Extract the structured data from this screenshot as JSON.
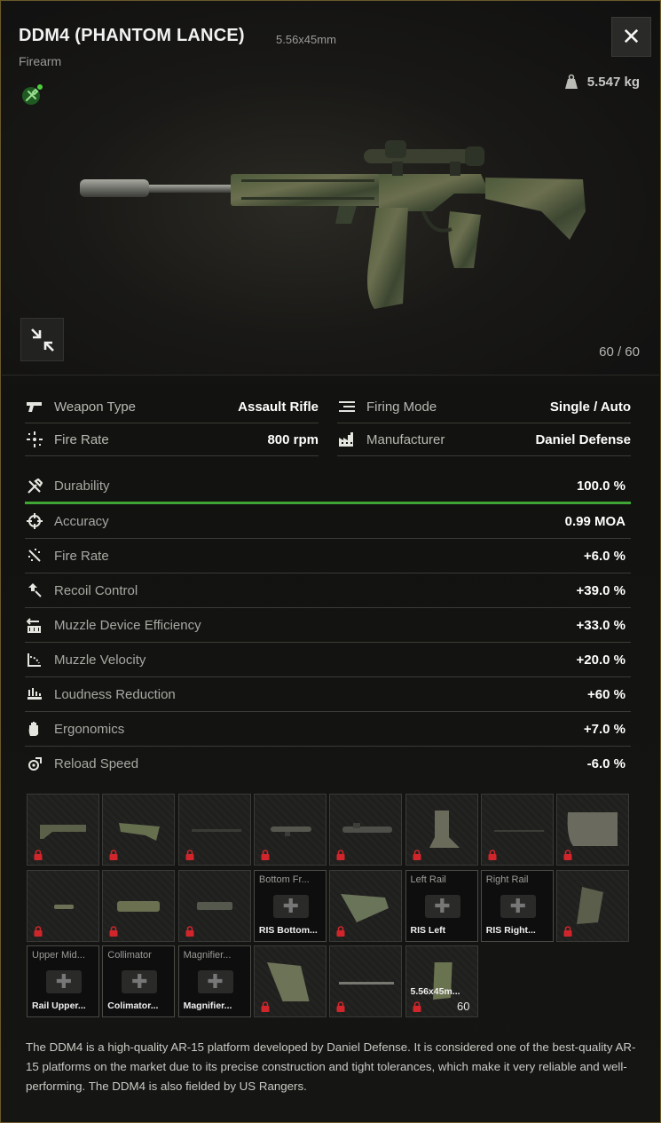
{
  "header": {
    "title": "DDM4 (PHANTOM LANCE)",
    "caliber": "5.56x45mm",
    "category": "Firearm",
    "weight": "5.547 kg",
    "close_glyph": "✕",
    "ammo": "60 / 60"
  },
  "info": [
    {
      "icon": "pistol-icon",
      "label": "Weapon Type",
      "value": "Assault Rifle"
    },
    {
      "icon": "firing-mode-icon",
      "label": "Firing Mode",
      "value": "Single / Auto"
    },
    {
      "icon": "fire-rate-icon",
      "label": "Fire Rate",
      "value": "800 rpm"
    },
    {
      "icon": "factory-icon",
      "label": "Manufacturer",
      "value": "Daniel Defense"
    }
  ],
  "stats": [
    {
      "icon": "wrench-icon",
      "label": "Durability",
      "value": "100.0 %",
      "level": 1.0
    },
    {
      "icon": "crosshair-icon",
      "label": "Accuracy",
      "value": "0.99 MOA"
    },
    {
      "icon": "fire-rate-icon",
      "label": "Fire Rate",
      "value": "+6.0 %"
    },
    {
      "icon": "recoil-icon",
      "label": "Recoil Control",
      "value": "+39.0 %"
    },
    {
      "icon": "muzzle-device-icon",
      "label": "Muzzle Device Efficiency",
      "value": "+33.0 %"
    },
    {
      "icon": "muzzle-velocity-icon",
      "label": "Muzzle Velocity",
      "value": "+20.0 %"
    },
    {
      "icon": "loudness-icon",
      "label": "Loudness Reduction",
      "value": "+60 %"
    },
    {
      "icon": "hand-icon",
      "label": "Ergonomics",
      "value": "+7.0 %"
    },
    {
      "icon": "reload-icon",
      "label": "Reload Speed",
      "value": "-6.0 %"
    }
  ],
  "slots": [
    {
      "name": "",
      "sub": "",
      "part": "stock",
      "locked": true
    },
    {
      "name": "",
      "sub": "",
      "part": "stock-tube",
      "locked": true
    },
    {
      "name": "",
      "sub": "",
      "part": "barrel-thin",
      "locked": true
    },
    {
      "name": "",
      "sub": "",
      "part": "scope-small",
      "locked": true
    },
    {
      "name": "",
      "sub": "",
      "part": "scope-long",
      "locked": true
    },
    {
      "name": "",
      "sub": "",
      "part": "sight-rear",
      "locked": true
    },
    {
      "name": "",
      "sub": "",
      "part": "rod",
      "locked": true
    },
    {
      "name": "",
      "sub": "",
      "part": "mount",
      "locked": true
    },
    {
      "name": "",
      "sub": "",
      "part": "gas-block",
      "locked": true
    },
    {
      "name": "",
      "sub": "",
      "part": "suppressor",
      "locked": true
    },
    {
      "name": "",
      "sub": "",
      "part": "handguard-small",
      "locked": true
    },
    {
      "name": "Bottom Fr...",
      "sub": "RIS Bottom...",
      "part": "empty",
      "locked": false
    },
    {
      "name": "",
      "sub": "",
      "part": "angled-grip",
      "locked": true
    },
    {
      "name": "Left Rail",
      "sub": "RIS Left",
      "part": "empty",
      "locked": false
    },
    {
      "name": "Right Rail",
      "sub": "RIS Right...",
      "part": "empty",
      "locked": false
    },
    {
      "name": "",
      "sub": "",
      "part": "pistol-grip",
      "locked": true
    },
    {
      "name": "Upper Mid...",
      "sub": "Rail Upper...",
      "part": "empty",
      "locked": false
    },
    {
      "name": "Collimator",
      "sub": "Colimator...",
      "part": "empty-sight",
      "locked": false
    },
    {
      "name": "Magnifier...",
      "sub": "Magnifier...",
      "part": "empty",
      "locked": false
    },
    {
      "name": "",
      "sub": "",
      "part": "grip-large",
      "locked": true
    },
    {
      "name": "",
      "sub": "",
      "part": "rod-long",
      "locked": true
    },
    {
      "name": "",
      "sub": "5.56x45m...",
      "part": "magazine",
      "locked": true,
      "count": "60"
    }
  ],
  "description": "The DDM4 is a high-quality AR-15 platform developed by Daniel Defense. It is considered one of the best-quality AR-15 platforms on the market due to its precise construction and tight tolerances, which make it very reliable and well-performing. The DDM4 is also fielded by US Rangers.",
  "colors": {
    "accent_green": "#3fa535",
    "lock_red": "#d0262b",
    "border_gold": "#6a5a2c"
  }
}
